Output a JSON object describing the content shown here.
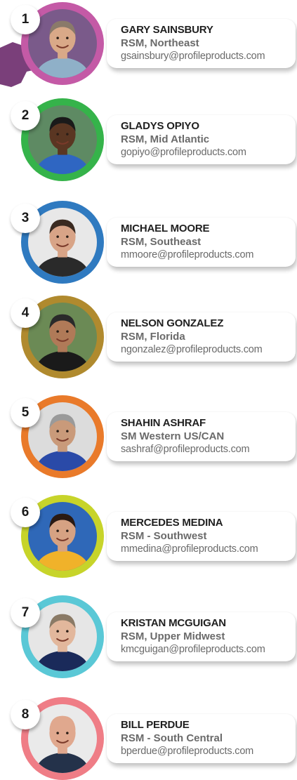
{
  "reps": [
    {
      "number": "1",
      "name": "GARY SAINSBURY",
      "title": "RSM, Northeast",
      "email": "gsainsbury@profileproducts.com",
      "ring_color": "#c45aa6",
      "photo_bg": "#7a5a8a",
      "skin": "#d9a988",
      "hair": "#8a7a6a",
      "shirt": "#8fb0c8"
    },
    {
      "number": "2",
      "name": "GLADYS OPIYO",
      "title": "RSM, Mid Atlantic",
      "email": "gopiyo@profileproducts.com",
      "ring_color": "#35b34a",
      "photo_bg": "#5e8a63",
      "skin": "#5a3622",
      "hair": "#1a1a1a",
      "shirt": "#2f66c2"
    },
    {
      "number": "3",
      "name": "MICHAEL MOORE",
      "title": "RSM, Southeast",
      "email": "mmoore@profileproducts.com",
      "ring_color": "#2f7ac0",
      "photo_bg": "#e8e8e8",
      "skin": "#d8a487",
      "hair": "#3a2a20",
      "shirt": "#2a2a2a"
    },
    {
      "number": "4",
      "name": "NELSON GONZALEZ",
      "title": "RSM, Florida",
      "email": "ngonzalez@profileproducts.com",
      "ring_color": "#b08a2e",
      "photo_bg": "#6b8a55",
      "skin": "#b07a58",
      "hair": "#2a2a2a",
      "shirt": "#1a1a1a"
    },
    {
      "number": "5",
      "name": "SHAHIN ASHRAF",
      "title": "SM Western US/CAN",
      "email": "sashraf@profileproducts.com",
      "ring_color": "#e97a2a",
      "photo_bg": "#dcdcdc",
      "skin": "#c99a7a",
      "hair": "#9a9a9a",
      "shirt": "#2a4aa8"
    },
    {
      "number": "6",
      "name": "MERCEDES MEDINA",
      "title": "RSM - Southwest",
      "email": "mmedina@profileproducts.com",
      "ring_color": "#c7d42a",
      "photo_bg": "#2f68b8",
      "skin": "#d6a283",
      "hair": "#2a1a14",
      "shirt": "#f0b22a"
    },
    {
      "number": "7",
      "name": "KRISTAN MCGUIGAN",
      "title": "RSM, Upper Midwest",
      "email": "kmcguigan@profileproducts.com",
      "ring_color": "#5ac8d6",
      "photo_bg": "#e6e6e6",
      "skin": "#e2b79c",
      "hair": "#8a7a66",
      "shirt": "#1a2a5a"
    },
    {
      "number": "8",
      "name": "BILL PERDUE",
      "title": "RSM - South Central",
      "email": "bperdue@profileproducts.com",
      "ring_color": "#ef7d86",
      "photo_bg": "#eaeaea",
      "skin": "#e0a88e",
      "hair": "#e0a88e",
      "shirt": "#24324a"
    }
  ]
}
